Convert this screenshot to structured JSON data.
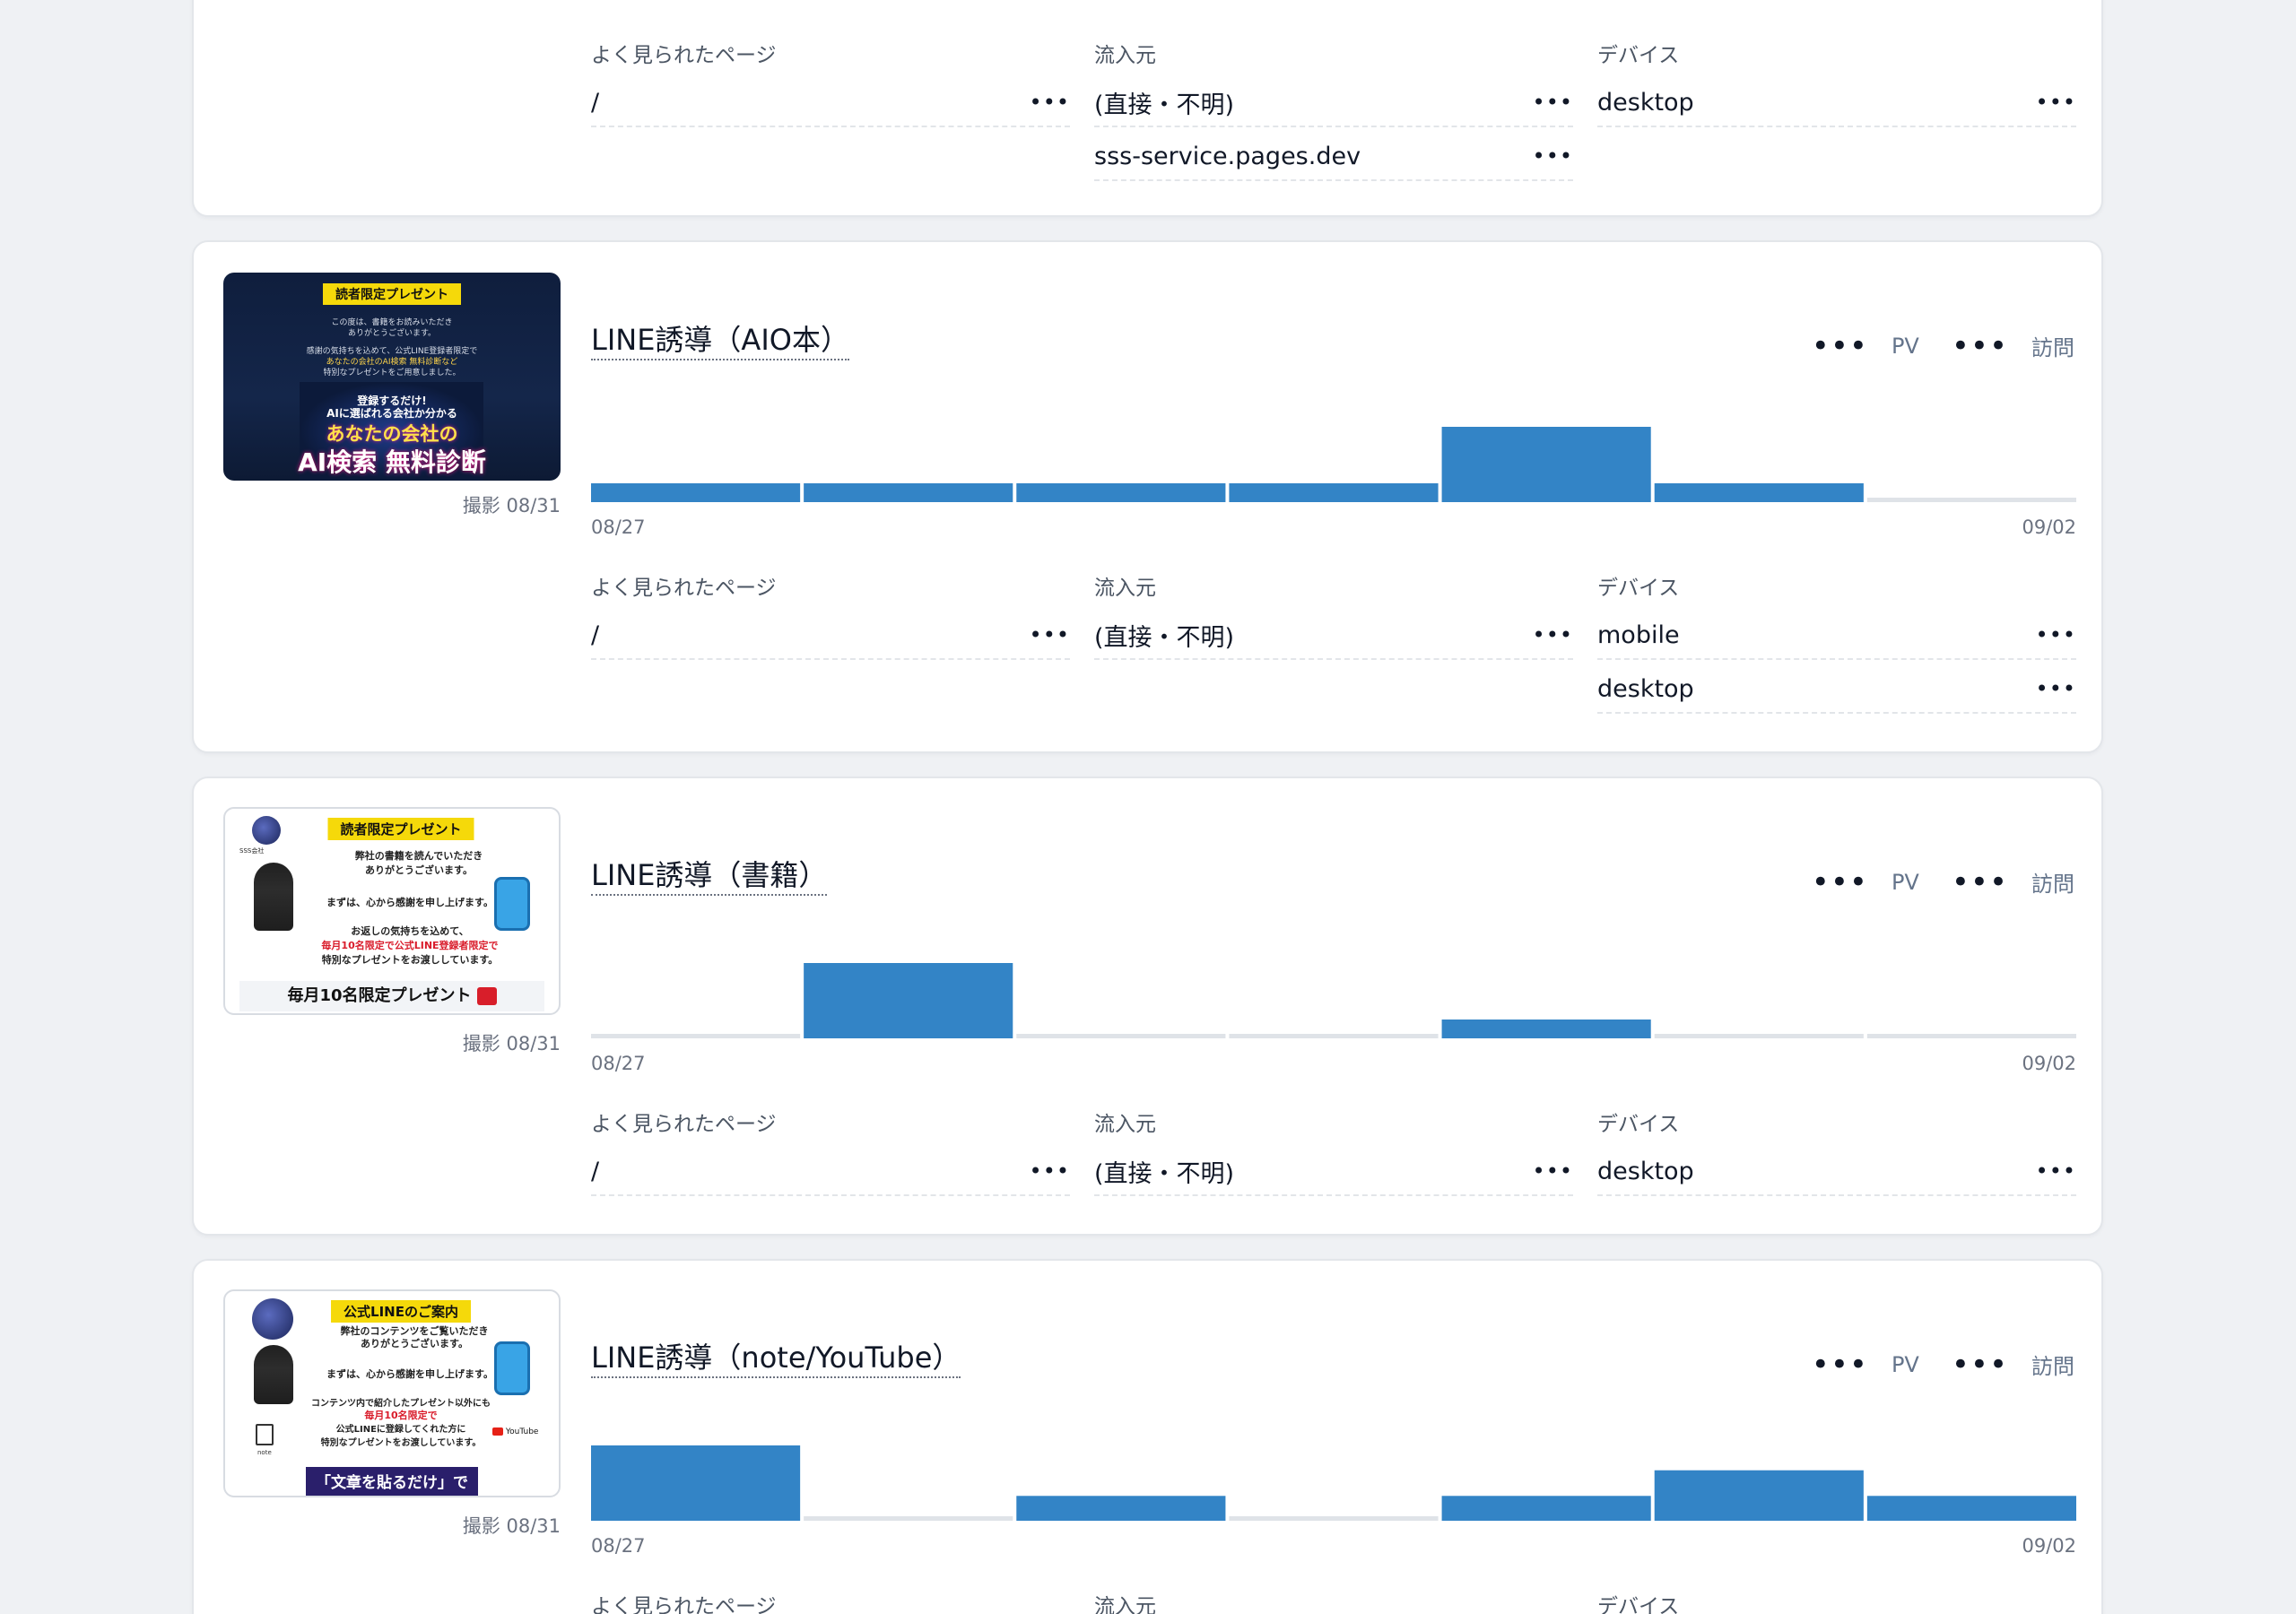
{
  "colors": {
    "bar": "#3384c6",
    "empty_bar": "#dfe3e8",
    "accent_badge": "#f5d90a"
  },
  "metrics": {
    "pv_label": "PV",
    "visits_label": "訪問",
    "hidden_value": "•••"
  },
  "section_titles": {
    "pages": "よく見られたページ",
    "sources": "流入元",
    "devices": "デバイス"
  },
  "menu_glyph": "•••",
  "top_card": {
    "pages": [
      "/"
    ],
    "sources": [
      "(直接・不明)",
      "sss-service.pages.dev"
    ],
    "devices": [
      "desktop"
    ]
  },
  "cards": [
    {
      "title": "LINE誘導（AIO本）",
      "caption": "撮影 08/31",
      "thumb_variant": "navy",
      "thumb_text": {
        "badge": "読者限定プレゼント",
        "lines": [
          "この度は、書籍をお読みいただき",
          "ありがとうございます。",
          "感謝の気持ちを込めて、公式LINE登録者限定で",
          "あなたの会社のAI検索 無料診断など",
          "特別なプレゼントをご用意しました。"
        ],
        "callout1": "登録するだけ!",
        "callout2": "AIに選ばれる会社か分かる",
        "headline1": "あなたの会社の",
        "headline2": "AI検索 無料診断"
      },
      "date_start": "08/27",
      "date_end": "09/02",
      "chart_values": [
        0.25,
        0.25,
        0.25,
        0.25,
        1.0,
        0.25,
        0
      ],
      "pages": [
        "/"
      ],
      "sources": [
        "(直接・不明)"
      ],
      "devices": [
        "mobile",
        "desktop"
      ]
    },
    {
      "title": "LINE誘導（書籍）",
      "caption": "撮影 08/31",
      "thumb_variant": "white",
      "thumb_text": {
        "badge": "読者限定プレゼント",
        "logo_label": "SSS会社",
        "lines": [
          "弊社の書籍を読んでいただき",
          "ありがとうございます。",
          "まずは、心から感謝を申し上げます。",
          "お返しの気持ちを込めて、"
        ],
        "red_line": "毎月10名限定で公式LINE登録者限定で",
        "line_after": "特別なプレゼントをお渡ししています。",
        "banner": "毎月10名限定プレゼント"
      },
      "date_start": "08/27",
      "date_end": "09/02",
      "chart_values": [
        0,
        1.0,
        0,
        0,
        0.25,
        0,
        0
      ],
      "pages": [
        "/"
      ],
      "sources": [
        "(直接・不明)"
      ],
      "devices": [
        "desktop"
      ]
    },
    {
      "title": "LINE誘導（note/YouTube）",
      "caption": "撮影 08/31",
      "thumb_variant": "white",
      "thumb_text": {
        "badge": "公式LINEのご案内",
        "lines": [
          "弊社のコンテンツをご覧いただき",
          "ありがとうございます。",
          "まずは、心から感謝を申し上げます。",
          "コンテンツ内で紹介したプレゼント以外にも"
        ],
        "red_line": "毎月10名限定で",
        "line_after": "公式LINEに登録してくれた方に",
        "line_after2": "特別なプレゼントをお渡ししています。",
        "youtube_label": "YouTube",
        "note_label": "note",
        "banner": "「文章を貼るだけ」で"
      },
      "date_start": "08/27",
      "date_end": "09/02",
      "chart_values": [
        1.0,
        0,
        0.33,
        0,
        0.33,
        0.67,
        0.33
      ],
      "pages": [],
      "sources": [],
      "devices": []
    }
  ]
}
